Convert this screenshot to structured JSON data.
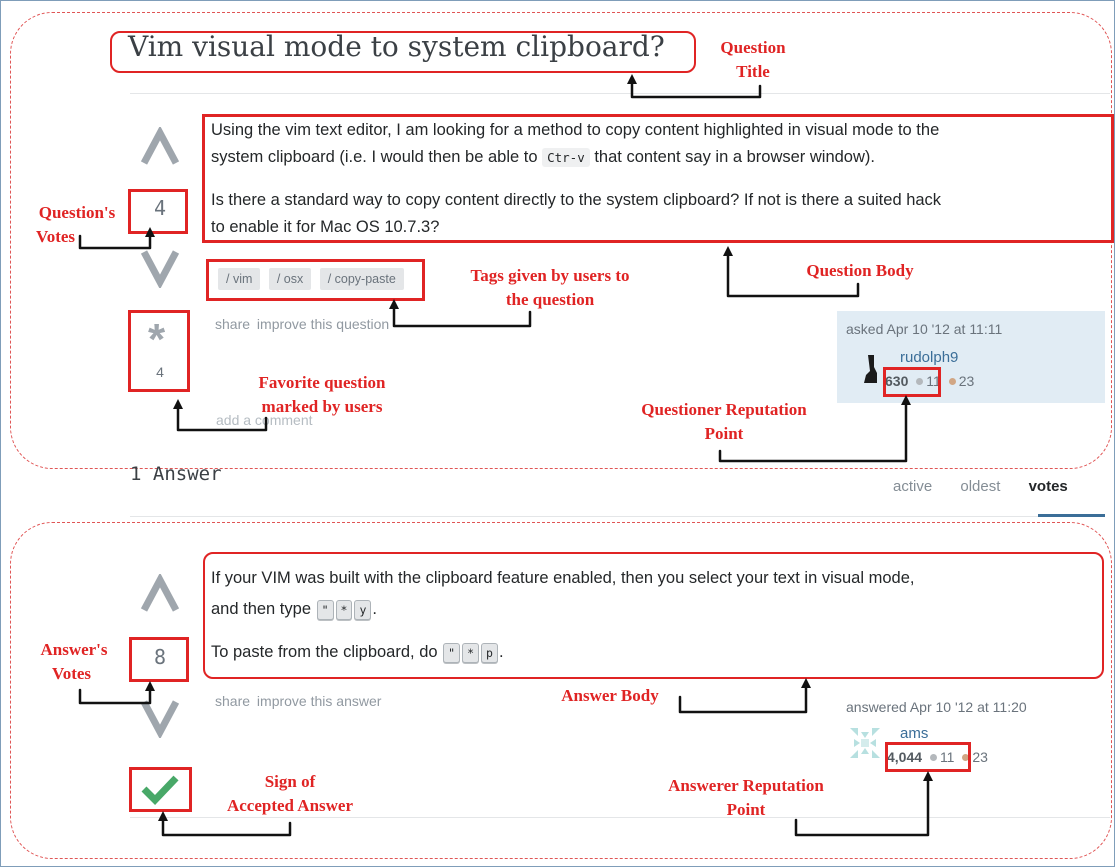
{
  "question": {
    "title": "Vim visual mode to system clipboard?",
    "body_p1_a": "Using the vim text editor, I am looking for a method to copy content highlighted in visual mode to the",
    "body_p1_b": "system clipboard (i.e. I would then be able to",
    "body_p1_code": "Ctr-v",
    "body_p1_c": "that content say in a browser window).",
    "body_p2_a": "Is there a standard way to copy content directly to the system clipboard? If not is there a suited hack",
    "body_p2_b": "to enable it for Mac OS 10.7.3?",
    "votes": "4",
    "favorites": "4",
    "tags": [
      "/ vim",
      "/ osx",
      "/ copy-paste"
    ],
    "share_label": "share",
    "improve_label": "improve this question",
    "add_comment": "add a comment",
    "asked_label": "asked Apr 10 '12 at 11:11",
    "user_name": "rudolph9",
    "user_rep": "630",
    "user_silver": "11",
    "user_bronze": "23"
  },
  "answers_header": {
    "count_label": "1 Answer",
    "sort_tabs": [
      "active",
      "oldest",
      "votes"
    ],
    "active_tab": "votes"
  },
  "answer": {
    "body_p1_a": "If your VIM was built with the clipboard feature enabled, then you select your text in visual mode,",
    "body_p1_b": "and then type",
    "keys1": [
      "\"",
      "*",
      "y"
    ],
    "body_p2_a": "To paste from the clipboard, do",
    "keys2": [
      "\"",
      "*",
      "p"
    ],
    "period": ".",
    "votes": "8",
    "share_label": "share",
    "improve_label": "improve this answer",
    "answered_label": "answered Apr 10 '12 at 11:20",
    "user_name": "ams",
    "user_rep": "4,044",
    "user_silver": "11",
    "user_bronze": "23"
  },
  "annotations": {
    "question_title": [
      "Question",
      "Title"
    ],
    "question_votes": [
      "Question's",
      "Votes"
    ],
    "question_body": "Question Body",
    "tags": [
      "Tags given by users to",
      "the question"
    ],
    "favorite": [
      "Favorite question",
      "marked by users"
    ],
    "questioner_rep": [
      "Questioner Reputation",
      "Point"
    ],
    "answer_votes": [
      "Answer's",
      "Votes"
    ],
    "answer_body": "Answer Body",
    "accepted": [
      "Sign of",
      "Accepted Answer"
    ],
    "answerer_rep": [
      "Answerer Reputation",
      "Point"
    ]
  },
  "colors": {
    "annotation_red": "#e02424",
    "accepted_green": "#48a868",
    "user_card_bg": "#e1ecf4"
  },
  "icons": {
    "upvote": "up-arrow-icon",
    "downvote": "down-arrow-icon",
    "favorite": "star-icon",
    "accepted": "checkmark-icon"
  }
}
